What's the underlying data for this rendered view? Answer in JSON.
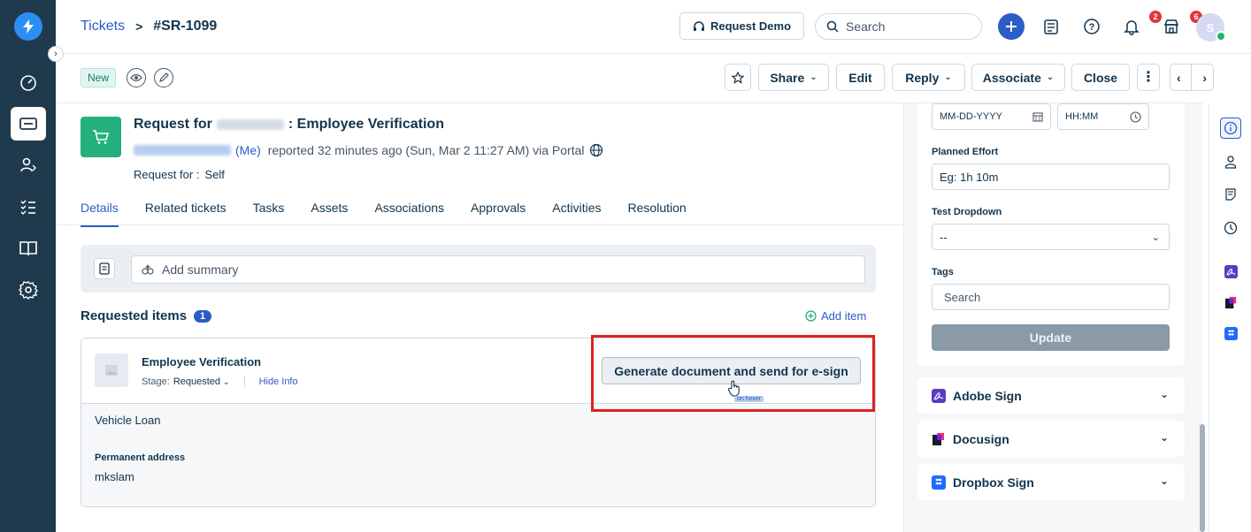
{
  "breadcrumb": {
    "root": "Tickets",
    "separator": ">",
    "current": "#SR-1099"
  },
  "header": {
    "request_demo": "Request Demo",
    "search_placeholder": "Search",
    "help_badge": "2",
    "notif_badge": "6",
    "avatar_initial": "S"
  },
  "toolbar": {
    "status": "New",
    "share": "Share",
    "edit": "Edit",
    "reply": "Reply",
    "associate": "Associate",
    "close": "Close"
  },
  "ticket": {
    "title_prefix": "Request for",
    "title_suffix": ": Employee Verification",
    "me": "(Me)",
    "reported": "reported 32 minutes ago (Sun, Mar 2 11:27 AM) via Portal",
    "request_for_label": "Request for :",
    "request_for_value": "Self"
  },
  "tabs": [
    "Details",
    "Related tickets",
    "Tasks",
    "Assets",
    "Associations",
    "Approvals",
    "Activities",
    "Resolution"
  ],
  "summary": {
    "placeholder": "Add summary"
  },
  "requested_items": {
    "label": "Requested items",
    "count": "1",
    "add_item": "Add item",
    "item_name": "Employee Verification",
    "stage_label": "Stage:",
    "stage_value": "Requested",
    "hide_info": "Hide Info",
    "generate_button": "Generate document and send for e-sign",
    "hover_tag": "on hover",
    "loan_type": "Vehicle Loan",
    "address_label": "Permanent address",
    "address_value": "mkslam"
  },
  "right_panel": {
    "date_placeholder": "MM-DD-YYYY",
    "time_placeholder": "HH:MM",
    "planned_effort_label": "Planned Effort",
    "planned_effort_placeholder": "Eg: 1h 10m",
    "test_dropdown_label": "Test Dropdown",
    "test_dropdown_value": "--",
    "tags_label": "Tags",
    "tags_placeholder": "Search",
    "update_button": "Update",
    "apps": [
      "Adobe Sign",
      "Docusign",
      "Dropbox Sign"
    ]
  },
  "colors": {
    "accent": "#2c5cc5",
    "nav_bg": "#1f3a4d",
    "highlight": "#e02020"
  }
}
